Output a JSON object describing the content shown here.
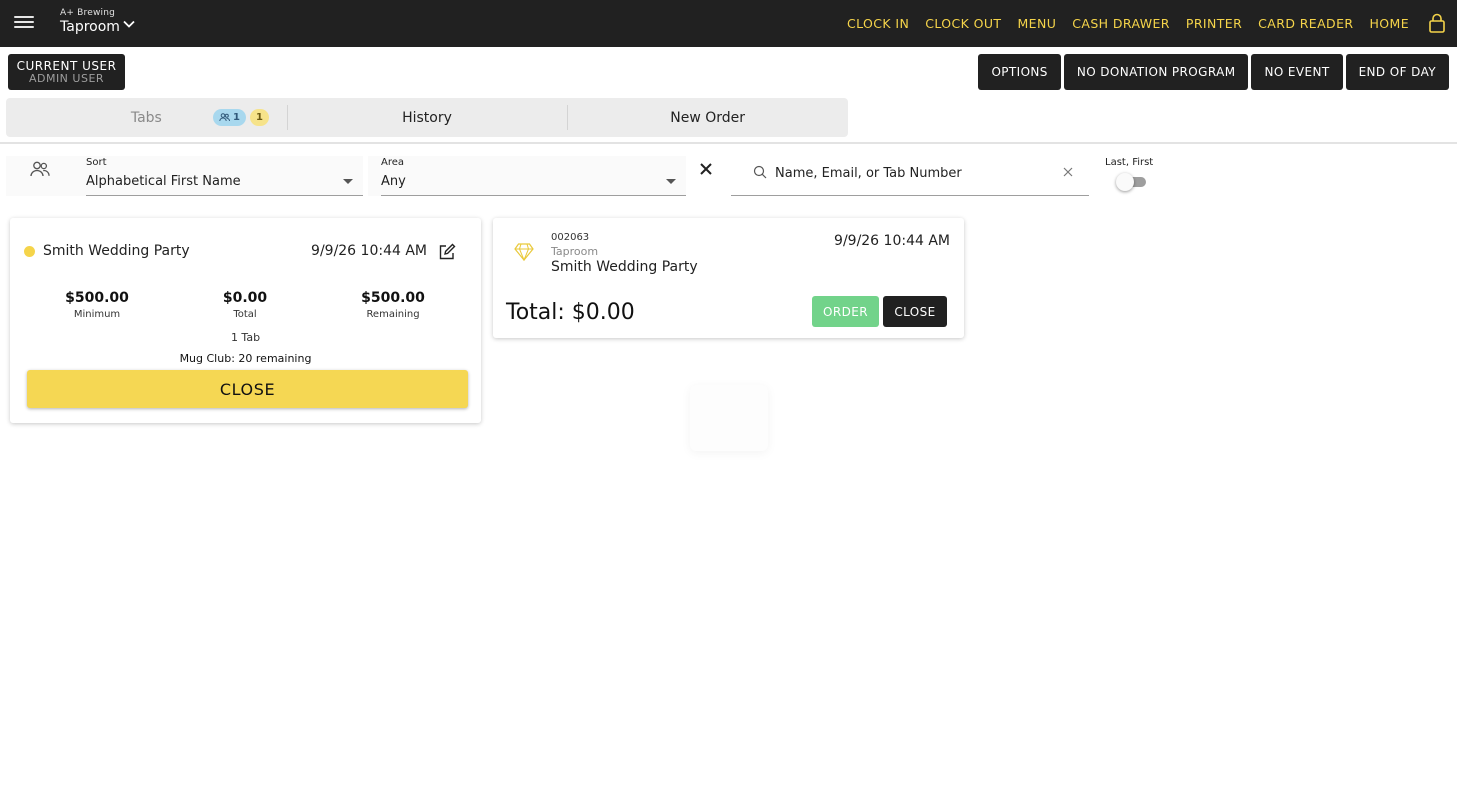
{
  "header": {
    "company": "A+ Brewing",
    "location": "Taproom",
    "nav": [
      "CLOCK IN",
      "CLOCK OUT",
      "MENU",
      "CASH DRAWER",
      "PRINTER",
      "CARD READER",
      "HOME"
    ]
  },
  "user": {
    "line1": "CURRENT USER",
    "line2": "ADMIN USER"
  },
  "actions": [
    "OPTIONS",
    "NO DONATION PROGRAM",
    "NO EVENT",
    "END OF DAY"
  ],
  "tabs": {
    "tabs_label": "Tabs",
    "badge_groups": "1",
    "badge_count": "1",
    "history_label": "History",
    "new_order_label": "New Order"
  },
  "filters": {
    "sort_label": "Sort",
    "sort_value": "Alphabetical First Name",
    "area_label": "Area",
    "area_value": "Any",
    "search_placeholder": "Name, Email, or Tab Number",
    "toggle_label": "Last, First"
  },
  "group_card": {
    "name": "Smith Wedding Party",
    "datetime": "9/9/26 10:44 AM",
    "minimum_value": "$500.00",
    "minimum_label": "Minimum",
    "total_value": "$0.00",
    "total_label": "Total",
    "remaining_value": "$500.00",
    "remaining_label": "Remaining",
    "tab_count": "1 Tab",
    "mug_club": "Mug Club: 20 remaining",
    "close_label": "CLOSE"
  },
  "tab_card": {
    "tab_number": "002063",
    "area": "Taproom",
    "name": "Smith Wedding Party",
    "datetime": "9/9/26 10:44 AM",
    "total": "Total: $0.00",
    "order_label": "ORDER",
    "close_label": "CLOSE"
  },
  "colors": {
    "topbar": "#212121",
    "nav_text": "#f5d44a",
    "accent_yellow": "#f5d753",
    "order_green": "#72d38a"
  }
}
